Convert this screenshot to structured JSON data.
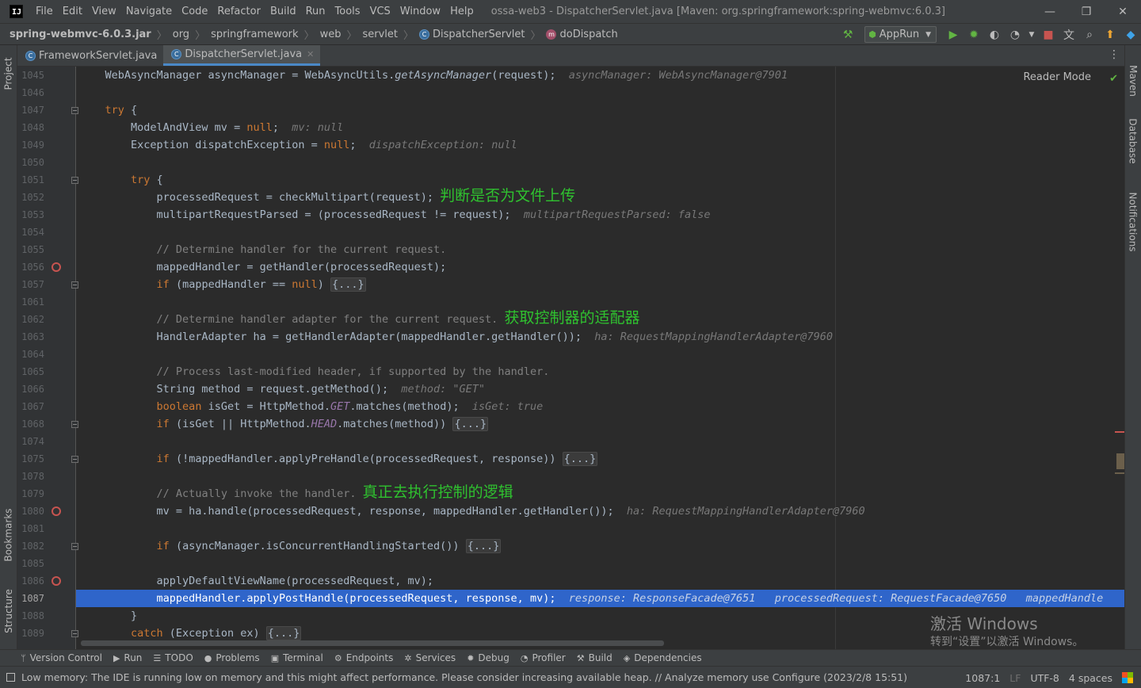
{
  "menu": [
    "File",
    "Edit",
    "View",
    "Navigate",
    "Code",
    "Refactor",
    "Build",
    "Run",
    "Tools",
    "VCS",
    "Window",
    "Help"
  ],
  "window_title": "ossa-web3 - DispatcherServlet.java [Maven: org.springframework:spring-webmvc:6.0.3]",
  "breadcrumb": {
    "jar": "spring-webmvc-6.0.3.jar",
    "p1": "org",
    "p2": "springframework",
    "p3": "web",
    "p4": "servlet",
    "cls": "DispatcherServlet",
    "method": "doDispatch"
  },
  "run_config": "AppRun",
  "tabs": [
    {
      "label": "FrameworkServlet.java",
      "active": false
    },
    {
      "label": "DispatcherServlet.java",
      "active": true
    }
  ],
  "left_tools": {
    "project": "Project",
    "bookmarks": "Bookmarks",
    "structure": "Structure"
  },
  "right_tools": {
    "maven": "Maven",
    "database": "Database",
    "notifications": "Notifications"
  },
  "reader_mode": "Reader Mode",
  "annotations": {
    "a1": "判断是否为文件上传",
    "a2": "获取控制器的适配器",
    "a3": "真正去执行控制的逻辑"
  },
  "lines": [
    {
      "n": "1045",
      "code": "    WebAsyncManager asyncManager = WebAsyncUtils.<i>getAsyncManager</i>(request);",
      "hint": "asyncManager: WebAsyncManager@7901"
    },
    {
      "n": "1046"
    },
    {
      "n": "1047",
      "code": "    <k>try</k> {",
      "fold": true
    },
    {
      "n": "1048",
      "code": "        ModelAndView mv = <k>null</k>;",
      "hint": "mv: null"
    },
    {
      "n": "1049",
      "code": "        Exception dispatchException = <k>null</k>;",
      "hint": "dispatchException: null"
    },
    {
      "n": "1050"
    },
    {
      "n": "1051",
      "code": "        <k>try</k> {",
      "fold": true
    },
    {
      "n": "1052",
      "code": "            processedRequest = checkMultipart(request);",
      "note": "a1"
    },
    {
      "n": "1053",
      "code": "            multipartRequestParsed = (processedRequest != request);",
      "hint": "multipartRequestParsed: false"
    },
    {
      "n": "1054"
    },
    {
      "n": "1055",
      "code": "            <c>// Determine handler for the current request.</c>"
    },
    {
      "n": "1056",
      "code": "            mappedHandler = getHandler(processedRequest);",
      "bp": true
    },
    {
      "n": "1057",
      "code": "            <k>if</k> (mappedHandler == <k>null</k>) <f>{...}</f>",
      "fold": true
    },
    {
      "n": "1061"
    },
    {
      "n": "1062",
      "code": "            <c>// Determine handler adapter for the current request.</c>",
      "note": "a2"
    },
    {
      "n": "1063",
      "code": "            HandlerAdapter ha = getHandlerAdapter(mappedHandler.getHandler());",
      "hint": "ha: RequestMappingHandlerAdapter@7960"
    },
    {
      "n": "1064"
    },
    {
      "n": "1065",
      "code": "            <c>// Process last-modified header, if supported by the handler.</c>"
    },
    {
      "n": "1066",
      "code": "            String method = request.getMethod();",
      "hint": "method: \"GET\""
    },
    {
      "n": "1067",
      "code": "            <k>boolean</k> isGet = HttpMethod.<s>GET</s>.matches(method);",
      "hint": "isGet: true"
    },
    {
      "n": "1068",
      "code": "            <k>if</k> (isGet || HttpMethod.<s>HEAD</s>.matches(method)) <f>{...}</f>",
      "fold": true
    },
    {
      "n": "1074"
    },
    {
      "n": "1075",
      "code": "            <k>if</k> (!mappedHandler.applyPreHandle(processedRequest, response)) <f>{...}</f>",
      "fold": true
    },
    {
      "n": "1078"
    },
    {
      "n": "1079",
      "code": "            <c>// Actually invoke the handler.</c>",
      "note": "a3"
    },
    {
      "n": "1080",
      "code": "            mv = ha.handle(processedRequest, response, mappedHandler.getHandler());",
      "hint": "ha: RequestMappingHandlerAdapter@7960",
      "bp": true
    },
    {
      "n": "1081"
    },
    {
      "n": "1082",
      "code": "            <k>if</k> (asyncManager.isConcurrentHandlingStarted()) <f>{...}</f>",
      "fold": true
    },
    {
      "n": "1085"
    },
    {
      "n": "1086",
      "code": "            applyDefaultViewName(processedRequest, mv);",
      "bp": true
    },
    {
      "n": "1087",
      "code": "            mappedHandler.applyPostHandle(processedRequest, response, mv);",
      "hint": "response: ResponseFacade@7651   processedRequest: RequestFacade@7650   mappedHandle",
      "current": true
    },
    {
      "n": "1088",
      "code": "        }"
    },
    {
      "n": "1089",
      "code": "        <k>catch</k> (Exception ex) <f>{...}</f>",
      "fold": true
    }
  ],
  "watermark": {
    "line1": "激活 Windows",
    "line2": "转到“设置”以激活 Windows。"
  },
  "bottom_tools": [
    {
      "icon": "version-control-icon",
      "glyph": "ᛘ",
      "label": "Version Control"
    },
    {
      "icon": "run-icon",
      "glyph": "▶",
      "label": "Run"
    },
    {
      "icon": "todo-icon",
      "glyph": "☰",
      "label": "TODO"
    },
    {
      "icon": "problems-icon",
      "glyph": "●",
      "label": "Problems"
    },
    {
      "icon": "terminal-icon",
      "glyph": "▣",
      "label": "Terminal"
    },
    {
      "icon": "endpoints-icon",
      "glyph": "⚙",
      "label": "Endpoints"
    },
    {
      "icon": "services-icon",
      "glyph": "✲",
      "label": "Services"
    },
    {
      "icon": "debug-icon",
      "glyph": "✹",
      "label": "Debug"
    },
    {
      "icon": "profiler-icon",
      "glyph": "◔",
      "label": "Profiler"
    },
    {
      "icon": "build-icon",
      "glyph": "⚒",
      "label": "Build"
    },
    {
      "icon": "dependencies-icon",
      "glyph": "◈",
      "label": "Dependencies"
    }
  ],
  "status": {
    "message": "Low memory: The IDE is running low on memory and this might affect performance. Please consider increasing available heap. // Analyze memory use    Configure (2023/2/8 15:51)",
    "position": "1087:1",
    "line_sep": "LF",
    "encoding": "UTF-8",
    "indent": "4 spaces"
  },
  "colors": {
    "annotation": "#2fc22f",
    "current_line": "#2f65ca",
    "breakpoint": "#c75450",
    "keyword": "#cc7832"
  }
}
